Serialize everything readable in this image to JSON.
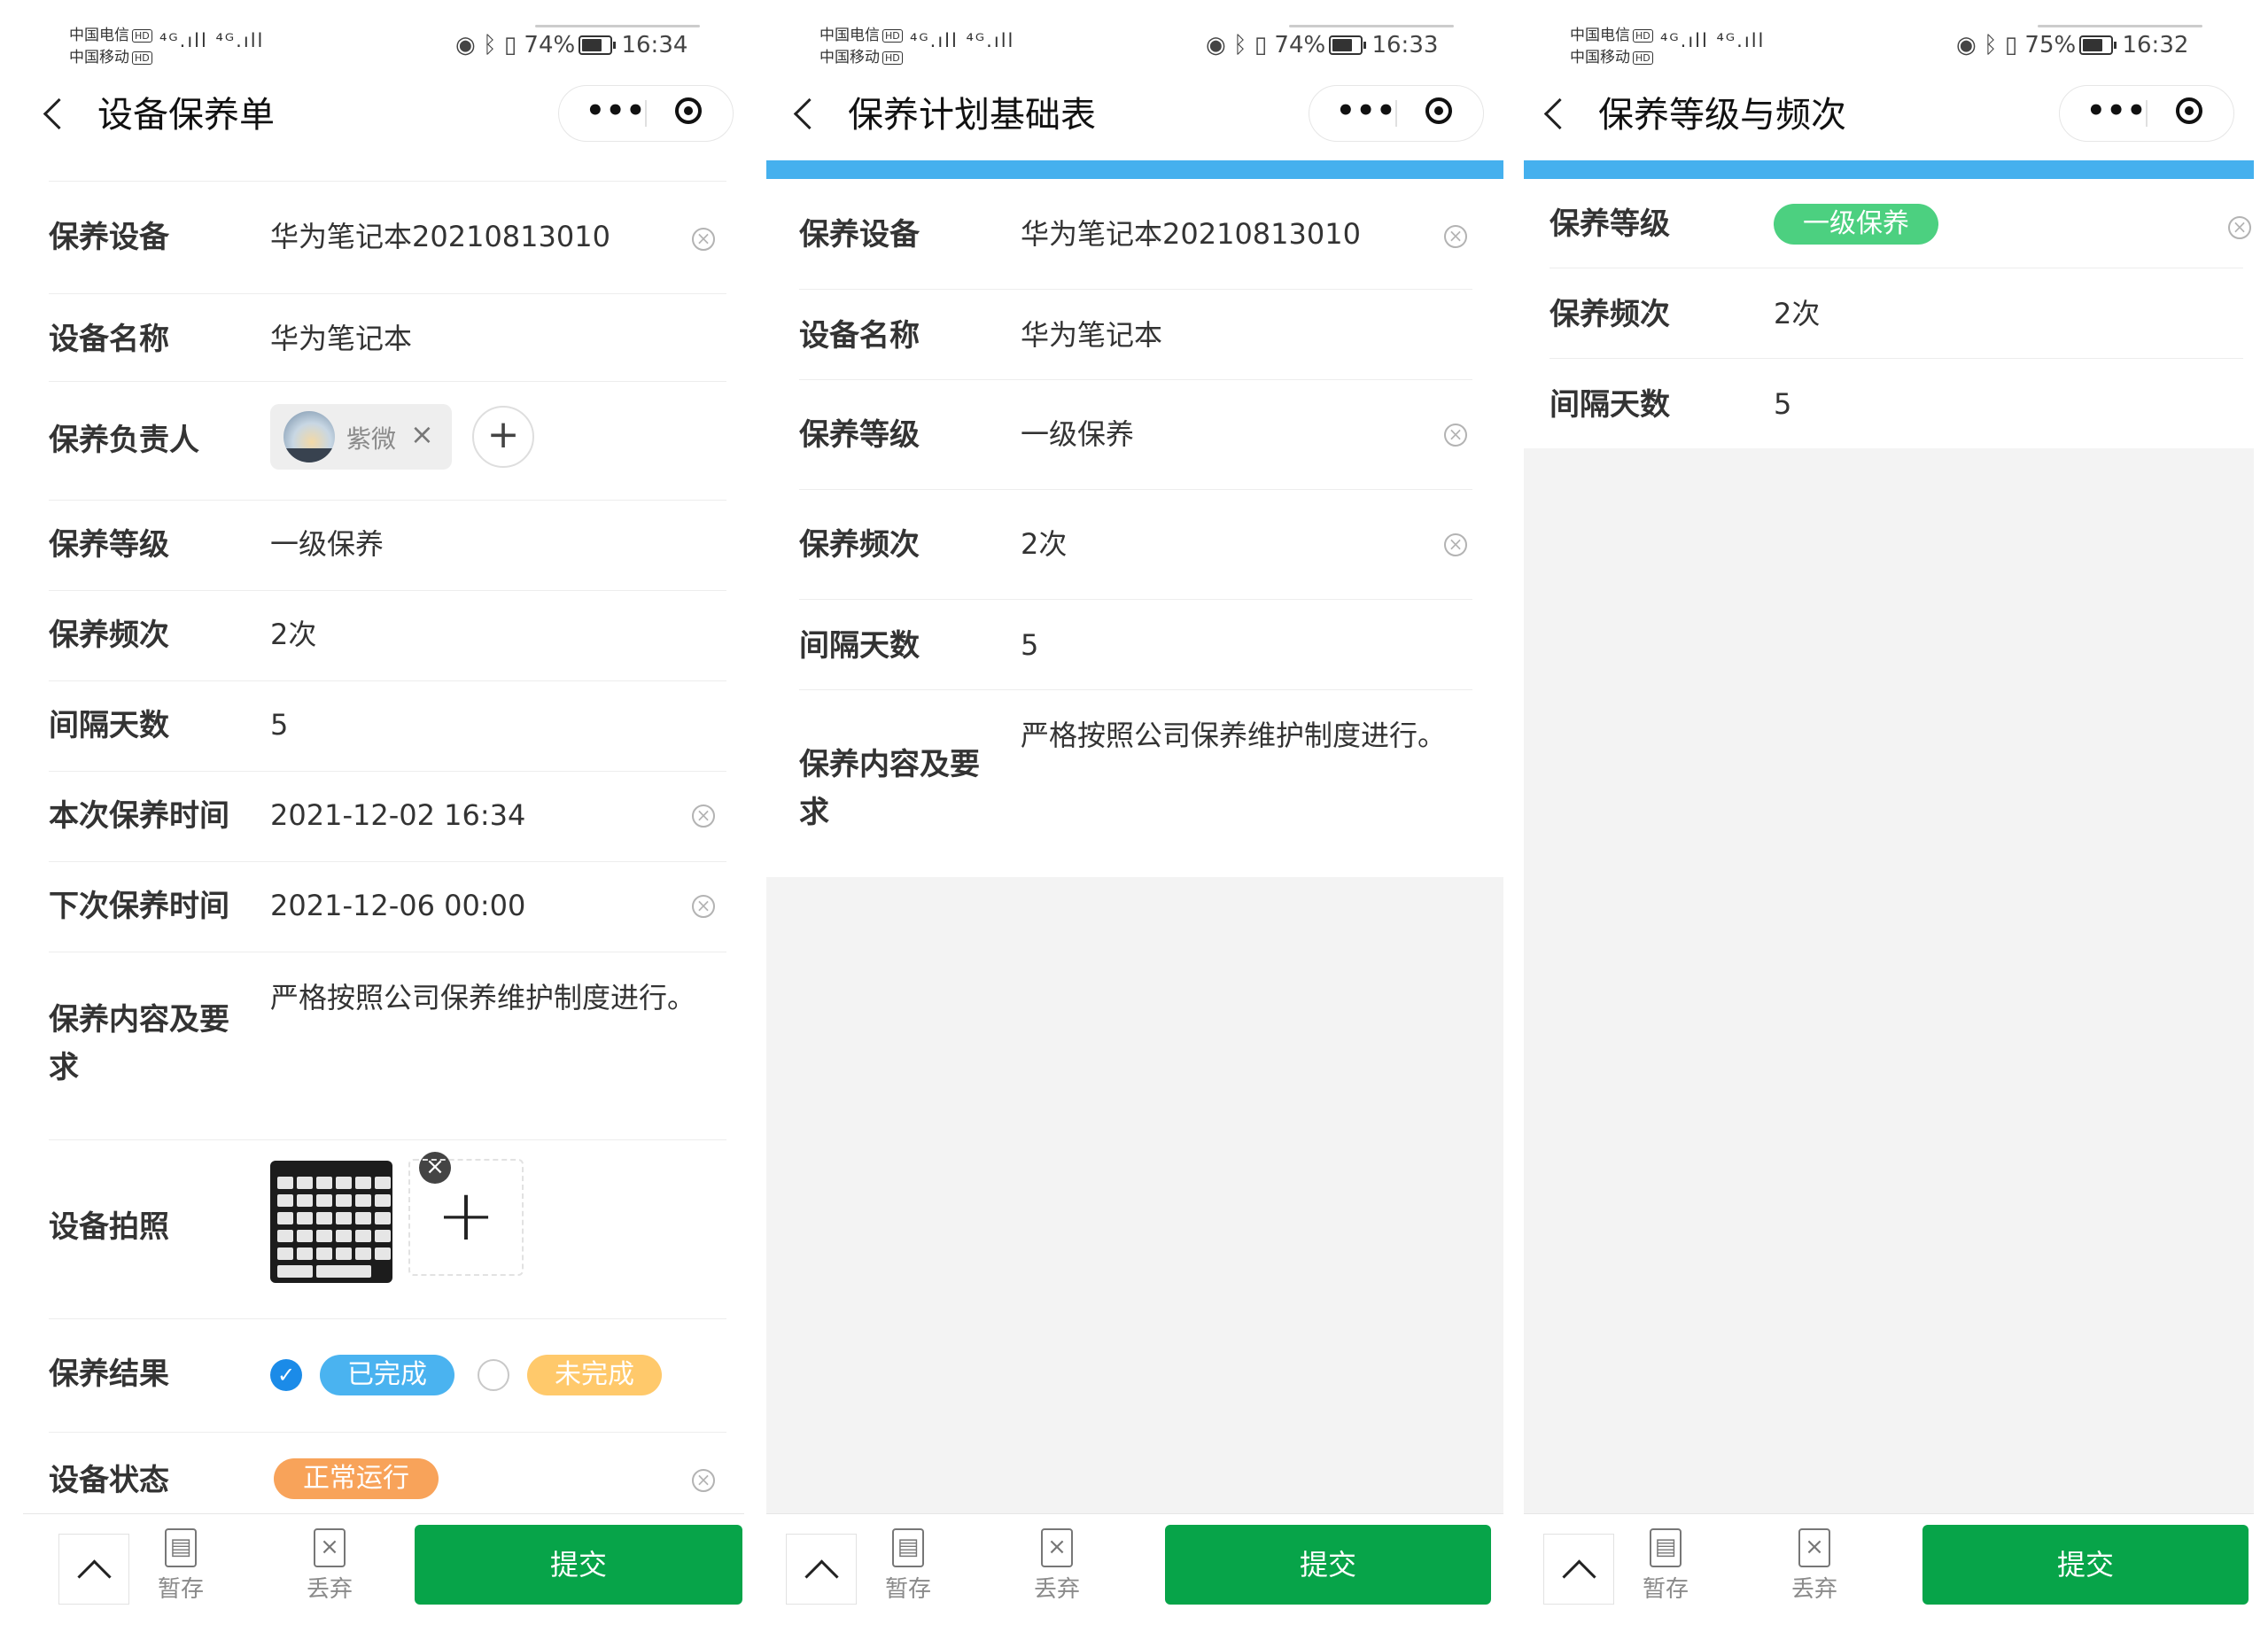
{
  "screens": [
    {
      "status": {
        "carrier1": "中国电信",
        "carrier2": "中国移动",
        "hd": "HD",
        "signal": "⁴ᴳ.ıll ⁴ᴳ.ıll",
        "battery": "74%",
        "time": "16:34"
      },
      "title": "设备保养单",
      "fields": {
        "device_label": "保养设备",
        "device_value": "华为笔记本20210813010",
        "name_label": "设备名称",
        "name_value": "华为笔记本",
        "owner_label": "保养负责人",
        "owner_chip": "紫微",
        "level_label": "保养等级",
        "level_value": "一级保养",
        "freq_label": "保养频次",
        "freq_value": "2次",
        "interval_label": "间隔天数",
        "interval_value": "5",
        "this_time_label": "本次保养时间",
        "this_time_value": "2021-12-02 16:34",
        "next_time_label": "下次保养时间",
        "next_time_value": "2021-12-06 00:00",
        "content_label_1": "保养内容及要",
        "content_label_2": "求",
        "content_value": "严格按照公司保养维护制度进行。",
        "photo_label": "设备拍照",
        "result_label": "保养结果",
        "result_done": "已完成",
        "result_undone": "未完成",
        "state_label": "设备状态",
        "state_value": "正常运行"
      },
      "bottom": {
        "save": "暂存",
        "discard": "丢弃",
        "submit": "提交"
      }
    },
    {
      "status": {
        "carrier1": "中国电信",
        "carrier2": "中国移动",
        "hd": "HD",
        "signal": "⁴ᴳ.ıll ⁴ᴳ.ıll",
        "battery": "74%",
        "time": "16:33"
      },
      "title": "保养计划基础表",
      "fields": {
        "device_label": "保养设备",
        "device_value": "华为笔记本20210813010",
        "name_label": "设备名称",
        "name_value": "华为笔记本",
        "level_label": "保养等级",
        "level_value": "一级保养",
        "freq_label": "保养频次",
        "freq_value": "2次",
        "interval_label": "间隔天数",
        "interval_value": "5",
        "content_label_1": "保养内容及要",
        "content_label_2": "求",
        "content_value": "严格按照公司保养维护制度进行。"
      },
      "bottom": {
        "save": "暂存",
        "discard": "丢弃",
        "submit": "提交"
      }
    },
    {
      "status": {
        "carrier1": "中国电信",
        "carrier2": "中国移动",
        "hd": "HD",
        "signal": "⁴ᴳ.ıll ⁴ᴳ.ıll",
        "battery": "75%",
        "time": "16:32"
      },
      "title": "保养等级与频次",
      "fields": {
        "level_label": "保养等级",
        "level_tag": "一级保养",
        "freq_label": "保养频次",
        "freq_value": "2次",
        "interval_label": "间隔天数",
        "interval_value": "5"
      },
      "bottom": {
        "save": "暂存",
        "discard": "丢弃",
        "submit": "提交"
      }
    }
  ],
  "colors": {
    "submit": "#07a449",
    "accent_blue": "#45b0ee",
    "tag_done": "#4ab3f0",
    "tag_undone": "#ffc96b",
    "tag_state": "#f8a35a",
    "tag_level": "#4cd080"
  },
  "icons": [
    "back-arrow-icon",
    "more-dots-icon",
    "close-target-icon",
    "clear-icon",
    "plus-icon",
    "check-icon",
    "chevron-up-icon",
    "save-doc-icon",
    "discard-doc-icon"
  ]
}
